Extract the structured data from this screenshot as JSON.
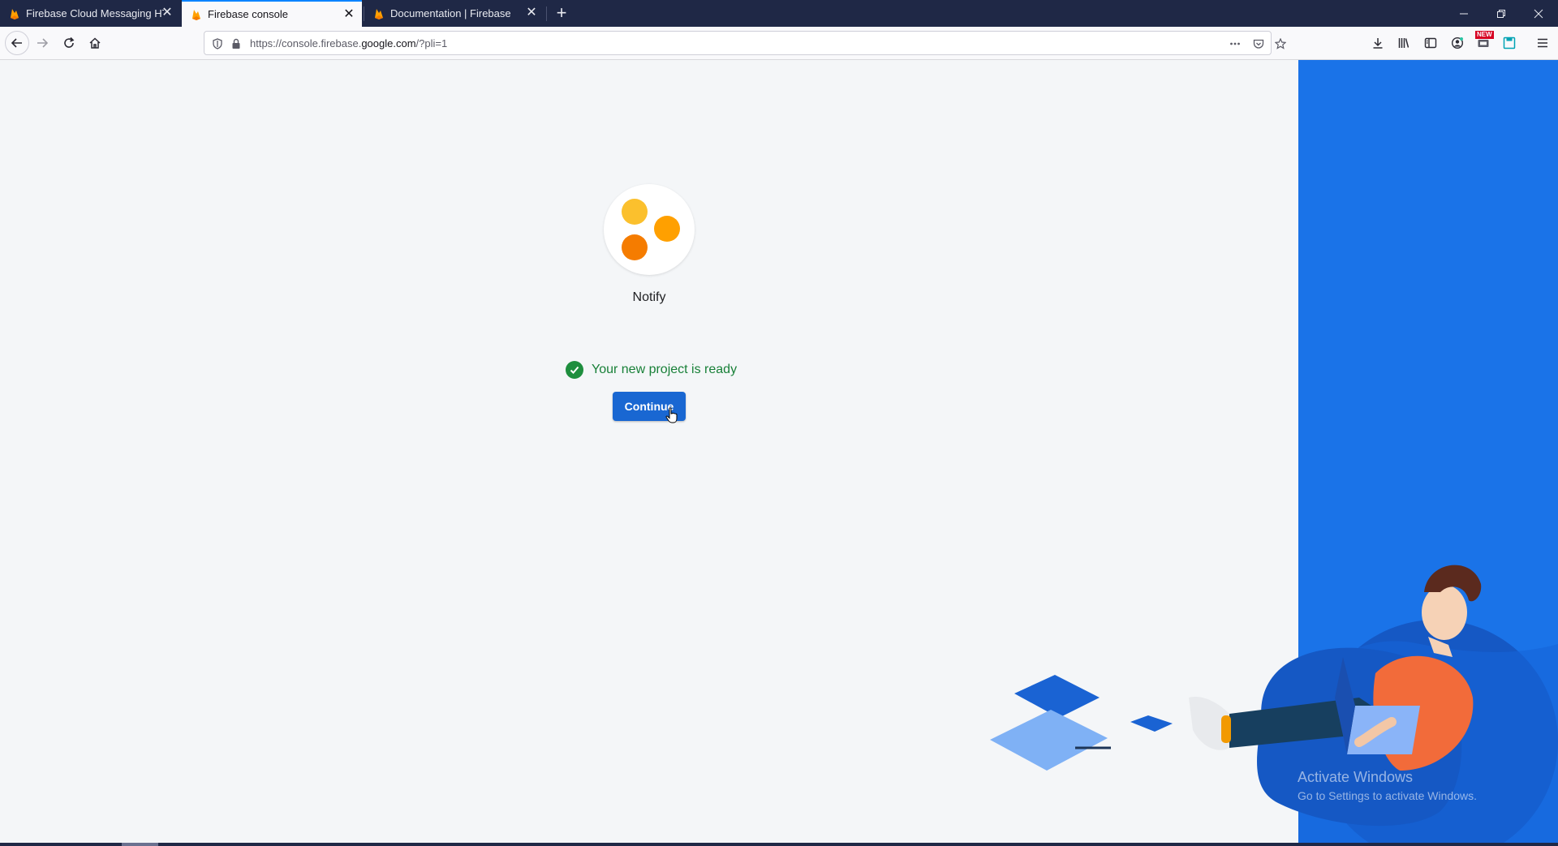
{
  "tabs": [
    {
      "title": "Firebase Cloud Messaging HTTP",
      "active": false
    },
    {
      "title": "Firebase console",
      "active": true
    },
    {
      "title": "Documentation  |  Firebase",
      "active": false
    }
  ],
  "icons": {
    "tab_favicon": "firebase-flame-icon",
    "new_tab": "plus-icon",
    "back": "arrow-left-icon",
    "forward": "arrow-right-icon",
    "reload": "reload-icon",
    "home": "home-icon",
    "tracking_protection": "shield-icon",
    "lock": "lock-icon",
    "page_actions": "more-dots-icon",
    "pocket": "pocket-icon",
    "bookmark": "star-icon",
    "downloads": "download-icon",
    "library": "library-icon",
    "sidebar": "sidebar-icon",
    "account": "account-icon",
    "extension": "extension-icon",
    "save": "save-icon",
    "menu": "hamburger-menu-icon",
    "ready_check": "check-circle-icon"
  },
  "url": {
    "prefix": "https://console.firebase.",
    "domain": "google.com",
    "path": "/?pli=1"
  },
  "extension_badge": "NEW",
  "project": {
    "name": "Notify",
    "status": "Your new project is ready",
    "continue_label": "Continue"
  },
  "watermark": {
    "line1": "Activate Windows",
    "line2": "Go to Settings to activate Windows."
  },
  "colors": {
    "accent_blue": "#1a73e8",
    "button_blue": "#1967d2",
    "success_green": "#1e8e3e",
    "dot_yellow": "#fbc02d",
    "dot_orange": "#ffa000",
    "dot_dark_orange": "#f57c00",
    "tabstrip": "#1f2846"
  }
}
